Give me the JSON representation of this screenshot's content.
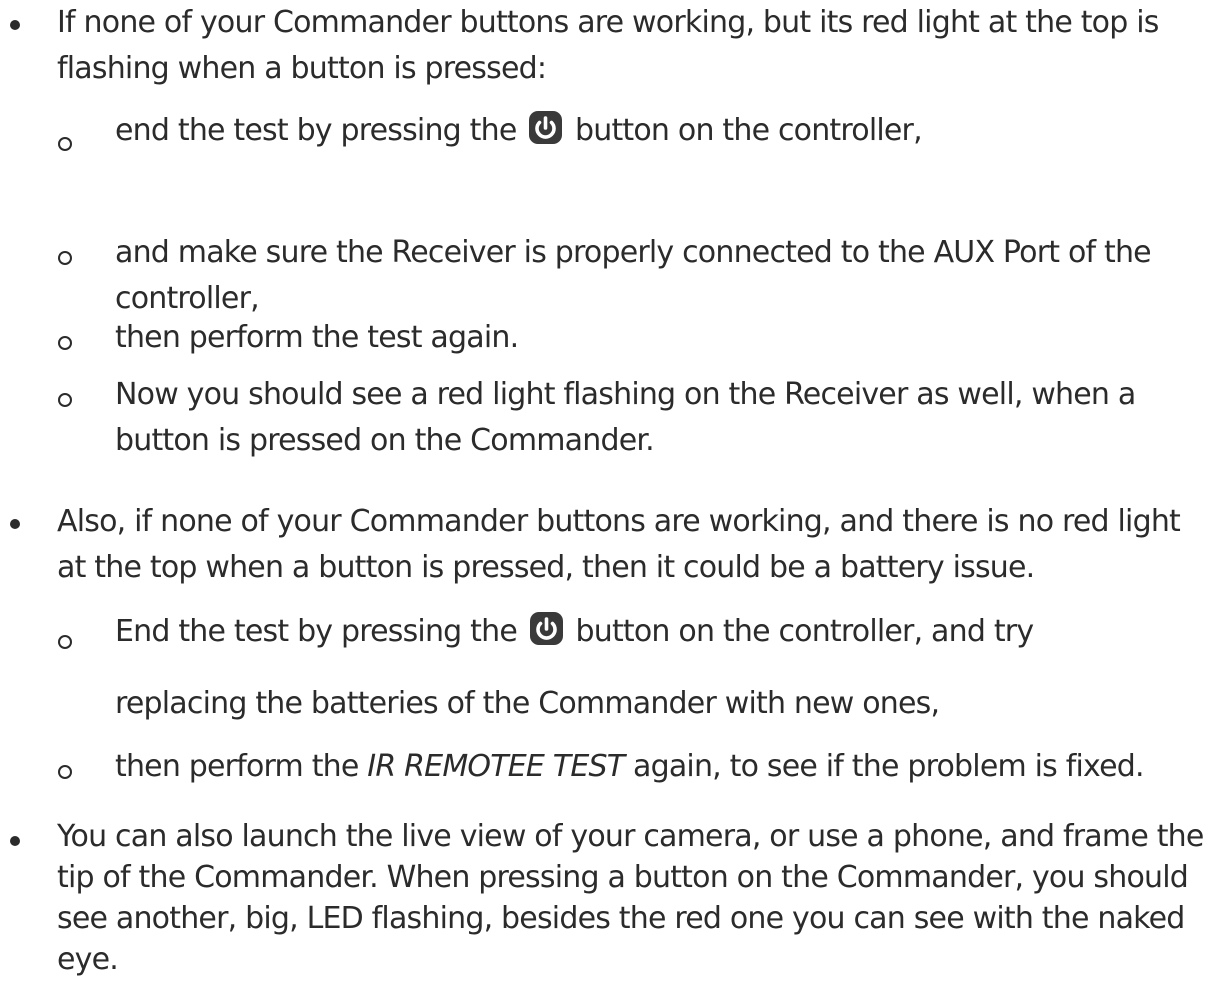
{
  "bullets": [
    {
      "text": "If none of your Commander buttons are working, but its red light at the top is flashing when a button is pressed:",
      "subs": [
        {
          "before": "end the test by pressing the",
          "icon": "power-icon",
          "after": "button on the controller,"
        },
        {
          "text": "and make sure the Receiver is properly connected to the AUX Port of the controller,"
        },
        {
          "text": "then perform the test again."
        },
        {
          "text": "Now you should see a red light flashing on the Receiver as well, when a button is pressed on the Commander."
        }
      ]
    },
    {
      "text": "Also, if none of your Commander buttons are working, and there is no red light at the top when a button is pressed, then it could be a battery issue.",
      "subs": [
        {
          "before": "End the test by pressing the",
          "icon": "power-icon",
          "after": "button on the controller, and try",
          "line2": "replacing the batteries of the Commander with new ones,"
        },
        {
          "before": "then perform the",
          "em": "IR REMOTEE TEST",
          "after": "again, to see if the problem is fixed."
        }
      ]
    },
    {
      "text": "You can also launch the live view of your camera, or use a phone, and frame the tip of the Commander. When pressing a button on the Commander, you should see another, big, LED flashing, besides the red one you can see with the naked eye."
    }
  ]
}
